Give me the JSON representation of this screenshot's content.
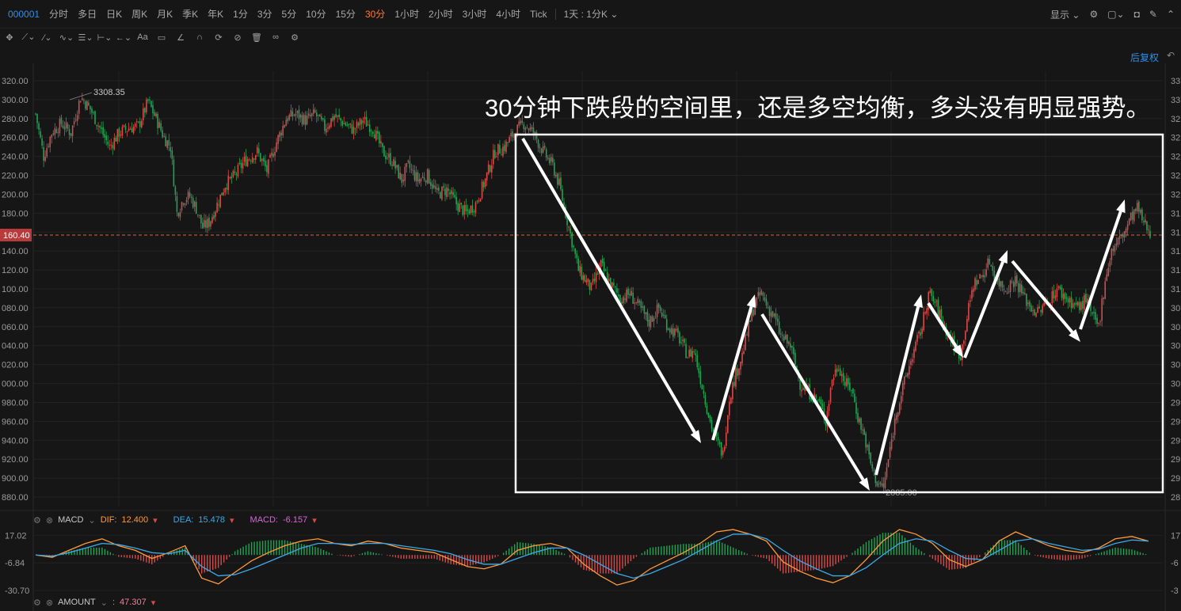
{
  "toolbar": {
    "code": "000001",
    "timeframes": [
      "分时",
      "多日",
      "日K",
      "周K",
      "月K",
      "季K",
      "年K",
      "1分",
      "3分",
      "5分",
      "10分",
      "15分",
      "30分",
      "1小时",
      "2小时",
      "3小时",
      "4小时",
      "Tick"
    ],
    "active_timeframe": "30分",
    "range_label": "1天 : 1分K",
    "display_label": "显示"
  },
  "adjust_label": "后复权",
  "annotation": "30分钟下跌段的空间里，还是多空均衡，多头没有明显强势。",
  "colors": {
    "up": "#d84a4a",
    "down": "#21a353",
    "accent": "#ff7a2b",
    "link": "#2f8fe8",
    "box": "#ffffff"
  },
  "price_axis": {
    "labels": [
      "320.00",
      "300.00",
      "280.00",
      "260.00",
      "240.00",
      "220.00",
      "200.00",
      "180.00",
      "160.40",
      "140.00",
      "120.00",
      "100.00",
      "080.00",
      "060.00",
      "040.00",
      "020.00",
      "000.00",
      "980.00",
      "960.00",
      "940.00",
      "920.00",
      "900.00",
      "880.00"
    ],
    "current_label": "160.40",
    "right_labels": [
      "33",
      "33",
      "32",
      "32",
      "32",
      "32",
      "32",
      "31",
      "31",
      "31",
      "31",
      "31",
      "30",
      "30",
      "30",
      "30",
      "30",
      "29",
      "29",
      "29",
      "29",
      "29",
      "28"
    ]
  },
  "markers": {
    "high_label": "3308.35",
    "low_label": "2885.00"
  },
  "macd": {
    "name": "MACD",
    "dif_label": "DIF:",
    "dif_value": "12.400",
    "dea_label": "DEA:",
    "dea_value": "15.478",
    "macd_label": "MACD:",
    "macd_value": "-6.157",
    "axis": [
      "17.02",
      "-6.84",
      "-30.70"
    ],
    "right_axis": [
      "17",
      "-6",
      "-3"
    ]
  },
  "amount": {
    "name": "AMOUNT",
    "sep": ":",
    "value": "47.307"
  },
  "chart_data": {
    "type": "candlestick",
    "title": "",
    "ylim": [
      2870,
      3330
    ],
    "high": 3308.35,
    "low": 2885.0,
    "current": 3160.4,
    "close_path": [
      [
        0,
        3285
      ],
      [
        5,
        3240
      ],
      [
        10,
        3265
      ],
      [
        16,
        3275
      ],
      [
        22,
        3265
      ],
      [
        28,
        3303
      ],
      [
        34,
        3290
      ],
      [
        40,
        3270
      ],
      [
        46,
        3250
      ],
      [
        52,
        3265
      ],
      [
        58,
        3270
      ],
      [
        64,
        3272
      ],
      [
        70,
        3298
      ],
      [
        75,
        3280
      ],
      [
        80,
        3260
      ],
      [
        84,
        3250
      ],
      [
        88,
        3180
      ],
      [
        92,
        3195
      ],
      [
        96,
        3198
      ],
      [
        100,
        3185
      ],
      [
        104,
        3165
      ],
      [
        108,
        3170
      ],
      [
        112,
        3185
      ],
      [
        118,
        3210
      ],
      [
        124,
        3220
      ],
      [
        130,
        3235
      ],
      [
        138,
        3245
      ],
      [
        144,
        3225
      ],
      [
        150,
        3255
      ],
      [
        156,
        3280
      ],
      [
        162,
        3285
      ],
      [
        168,
        3278
      ],
      [
        174,
        3285
      ],
      [
        180,
        3270
      ],
      [
        186,
        3283
      ],
      [
        192,
        3275
      ],
      [
        198,
        3268
      ],
      [
        204,
        3278
      ],
      [
        210,
        3270
      ],
      [
        216,
        3245
      ],
      [
        222,
        3235
      ],
      [
        228,
        3215
      ],
      [
        232,
        3230
      ],
      [
        238,
        3215
      ],
      [
        244,
        3220
      ],
      [
        250,
        3200
      ],
      [
        256,
        3205
      ],
      [
        262,
        3190
      ],
      [
        268,
        3180
      ],
      [
        274,
        3190
      ],
      [
        280,
        3215
      ],
      [
        286,
        3245
      ],
      [
        292,
        3250
      ],
      [
        298,
        3265
      ],
      [
        304,
        3275
      ],
      [
        310,
        3265
      ],
      [
        316,
        3245
      ],
      [
        322,
        3230
      ],
      [
        326,
        3210
      ],
      [
        330,
        3180
      ],
      [
        334,
        3150
      ],
      [
        338,
        3120
      ],
      [
        342,
        3110
      ],
      [
        346,
        3100
      ],
      [
        352,
        3125
      ],
      [
        358,
        3105
      ],
      [
        364,
        3090
      ],
      [
        370,
        3095
      ],
      [
        376,
        3080
      ],
      [
        382,
        3065
      ],
      [
        388,
        3080
      ],
      [
        394,
        3060
      ],
      [
        400,
        3050
      ],
      [
        406,
        3030
      ],
      [
        410,
        3035
      ],
      [
        416,
        2990
      ],
      [
        420,
        2960
      ],
      [
        424,
        2940
      ],
      [
        428,
        2925
      ],
      [
        432,
        2985
      ],
      [
        436,
        3010
      ],
      [
        440,
        3030
      ],
      [
        444,
        3060
      ],
      [
        448,
        3085
      ],
      [
        452,
        3095
      ],
      [
        456,
        3080
      ],
      [
        460,
        3070
      ],
      [
        464,
        3050
      ],
      [
        470,
        3040
      ],
      [
        476,
        3000
      ],
      [
        482,
        2990
      ],
      [
        488,
        2980
      ],
      [
        492,
        2960
      ],
      [
        496,
        3005
      ],
      [
        500,
        3020
      ],
      [
        504,
        3000
      ],
      [
        508,
        2995
      ],
      [
        512,
        2965
      ],
      [
        516,
        2945
      ],
      [
        520,
        2915
      ],
      [
        524,
        2895
      ],
      [
        528,
        2890
      ],
      [
        532,
        2930
      ],
      [
        536,
        2970
      ],
      [
        540,
        2995
      ],
      [
        546,
        3030
      ],
      [
        552,
        3060
      ],
      [
        556,
        3095
      ],
      [
        560,
        3085
      ],
      [
        566,
        3060
      ],
      [
        572,
        3040
      ],
      [
        576,
        3030
      ],
      [
        580,
        3070
      ],
      [
        584,
        3105
      ],
      [
        590,
        3115
      ],
      [
        594,
        3130
      ],
      [
        598,
        3110
      ],
      [
        604,
        3100
      ],
      [
        610,
        3110
      ],
      [
        616,
        3090
      ],
      [
        620,
        3080
      ],
      [
        624,
        3075
      ],
      [
        630,
        3085
      ],
      [
        636,
        3100
      ],
      [
        642,
        3090
      ],
      [
        646,
        3085
      ],
      [
        650,
        3080
      ],
      [
        654,
        3090
      ],
      [
        658,
        3070
      ],
      [
        662,
        3060
      ],
      [
        666,
        3110
      ],
      [
        670,
        3140
      ],
      [
        674,
        3150
      ],
      [
        678,
        3160
      ],
      [
        682,
        3175
      ],
      [
        686,
        3185
      ],
      [
        690,
        3170
      ],
      [
        694,
        3160
      ]
    ],
    "macd_series": [
      {
        "name": "DIF",
        "values": [
          0,
          -2,
          4,
          10,
          14,
          8,
          4,
          -3,
          2,
          8,
          -20,
          -25,
          -15,
          -5,
          2,
          8,
          12,
          14,
          10,
          8,
          12,
          10,
          6,
          4,
          2,
          -4,
          -10,
          -12,
          -8,
          4,
          8,
          10,
          6,
          -8,
          -18,
          -26,
          -22,
          -12,
          -5,
          2,
          10,
          20,
          22,
          18,
          12,
          -6,
          -14,
          -20,
          -24,
          -18,
          -4,
          12,
          22,
          18,
          10,
          -4,
          -10,
          -4,
          12,
          20,
          14,
          8,
          4,
          2,
          6,
          14,
          16,
          12
        ]
      },
      {
        "name": "DEA",
        "values": [
          0,
          -1,
          2,
          6,
          10,
          9,
          6,
          2,
          1,
          4,
          -10,
          -18,
          -17,
          -12,
          -6,
          0,
          6,
          10,
          10,
          9,
          10,
          10,
          8,
          6,
          4,
          1,
          -4,
          -8,
          -8,
          -3,
          2,
          6,
          6,
          0,
          -8,
          -16,
          -20,
          -16,
          -10,
          -4,
          4,
          12,
          18,
          18,
          14,
          4,
          -5,
          -12,
          -18,
          -18,
          -11,
          0,
          10,
          14,
          12,
          4,
          -3,
          -4,
          4,
          12,
          14,
          10,
          7,
          4,
          5,
          10,
          13,
          12
        ]
      }
    ]
  }
}
